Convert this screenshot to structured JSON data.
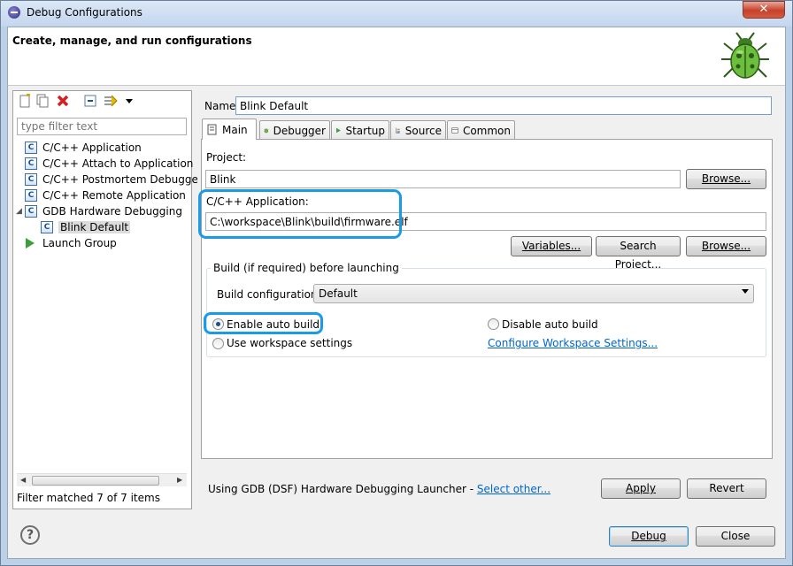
{
  "window": {
    "title": "Debug Configurations",
    "close_label": "✕"
  },
  "header": {
    "title": "Create, manage, and run configurations",
    "icon": "bug-icon"
  },
  "toolbar": {
    "icons": [
      "new-configuration-icon",
      "duplicate-icon",
      "delete-icon",
      "collapse-all-icon",
      "filter-icon",
      "dropdown-icon"
    ]
  },
  "filter": {
    "placeholder": "type filter text"
  },
  "tree": {
    "items": [
      {
        "label": "C/C++ Application",
        "icon": "c-icon"
      },
      {
        "label": "C/C++ Attach to Application",
        "icon": "c-icon"
      },
      {
        "label": "C/C++ Postmortem Debugger",
        "icon": "c-icon"
      },
      {
        "label": "C/C++ Remote Application",
        "icon": "c-icon"
      },
      {
        "label": "GDB Hardware Debugging",
        "icon": "c-icon"
      },
      {
        "label": "Blink Default",
        "icon": "c-icon",
        "selected": true
      },
      {
        "label": "Launch Group",
        "icon": "launch-icon"
      }
    ],
    "status": "Filter matched 7 of 7 items"
  },
  "config": {
    "name_label": "Name:",
    "name_value": "Blink Default",
    "tabs": [
      {
        "label": "Main",
        "icon": "main-tab-icon",
        "active": true
      },
      {
        "label": "Debugger",
        "icon": "debugger-icon"
      },
      {
        "label": "Startup",
        "icon": "startup-icon"
      },
      {
        "label": "Source",
        "icon": "source-icon"
      },
      {
        "label": "Common",
        "icon": "common-icon"
      }
    ],
    "main": {
      "project_label": "Project:",
      "project_value": "Blink",
      "browse_label": "Browse...",
      "app_label": "C/C++ Application:",
      "app_value": "C:\\workspace\\Blink\\build\\firmware.elf",
      "variables_label": "Variables...",
      "search_project_label": "Search Project...",
      "browse2_label": "Browse...",
      "build_group_title": "Build (if required) before launching",
      "build_config_label": "Build configuration:",
      "build_config_value": "Default",
      "radio_enable": "Enable auto build",
      "radio_disable": "Disable auto build",
      "radio_workspace": "Use workspace settings",
      "configure_link": "Configure Workspace Settings...",
      "selected_radio": "Enable auto build"
    },
    "launcher_text": "Using GDB (DSF) Hardware Debugging Launcher - ",
    "select_other": "Select other...",
    "apply_label": "Apply",
    "revert_label": "Revert"
  },
  "footer": {
    "help_label": "?",
    "debug_label": "Debug",
    "close_label": "Close"
  },
  "colors": {
    "highlight": "#1a9be8",
    "link": "#0066cc",
    "delete_red": "#d42020",
    "launch_green": "#3aa03a"
  }
}
